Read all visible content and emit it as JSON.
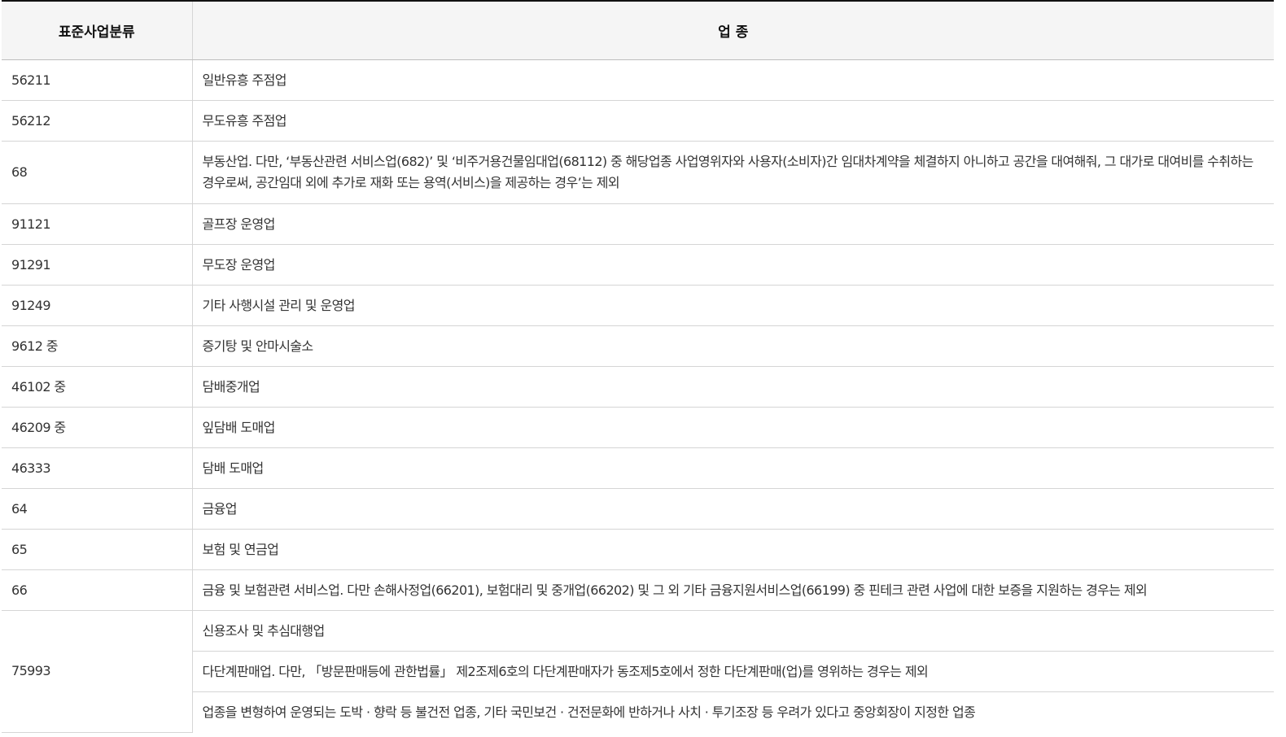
{
  "table": {
    "headers": [
      "표준사업분류",
      "업 종"
    ],
    "rows": [
      {
        "code": "56211",
        "industry": "일반유흥 주점업"
      },
      {
        "code": "56212",
        "industry": "무도유흥 주점업"
      },
      {
        "code": "68",
        "industry": "부동산업. 다만, ‘부동산관련 서비스업(682)’ 및 ‘비주거용건물임대업(68112) 중 해당업종 사업영위자와 사용자(소비자)간 임대차계약을 체결하지 아니하고 공간을 대여해줘, 그 대가로 대여비를 수취하는 경우로써, 공간임대 외에 추가로 재화 또는 용역(서비스)을 제공하는 경우’는 제외"
      },
      {
        "code": "91121",
        "industry": "골프장 운영업"
      },
      {
        "code": "91291",
        "industry": "무도장 운영업"
      },
      {
        "code": "91249",
        "industry": "기타 사행시설 관리 및 운영업"
      },
      {
        "code": "9612 중",
        "industry": "증기탕 및 안마시술소"
      },
      {
        "code": "46102 중",
        "industry": "담배중개업"
      },
      {
        "code": "46209 중",
        "industry": "잎담배 도매업"
      },
      {
        "code": "46333",
        "industry": "담배 도매업"
      },
      {
        "code": "64",
        "industry": "금융업"
      },
      {
        "code": "65",
        "industry": "보험 및 연금업"
      },
      {
        "code": "66",
        "industry": "금융 및 보험관련 서비스업. 다만 손해사정업(66201), 보험대리 및 중개업(66202) 및 그 외 기타 금융지원서비스업(66199) 중 핀테크 관련 사업에 대한 보증을 지원하는 경우는 제외"
      }
    ],
    "group": {
      "code": "75993",
      "industries": [
        "신용조사 및 추심대행업",
        "다단계판매업. 다만, 「방문판매등에 관한법률」 제2조제6호의 다단계판매자가 동조제5호에서 정한 다단계판매(업)를 영위하는 경우는 제외",
        "업종을 변형하여 운영되는 도박 · 향락 등 불건전 업종, 기타 국민보건 · 건전문화에 반하거나 사치 · 투기조장 등 우려가 있다고 중앙회장이 지정한 업종"
      ]
    }
  }
}
